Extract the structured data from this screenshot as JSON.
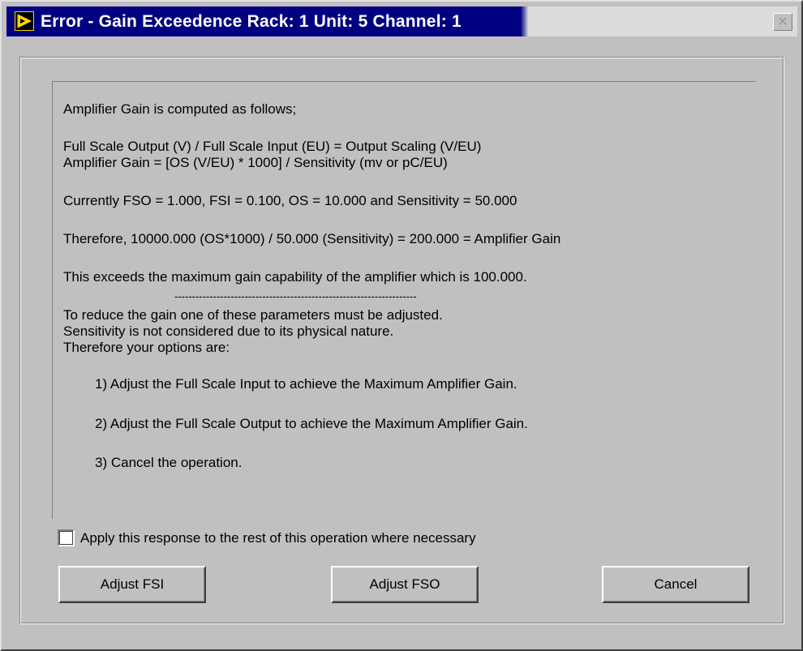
{
  "window": {
    "title": "Error - Gain Exceedence Rack: 1 Unit: 5 Channel: 1",
    "close_glyph": "✕"
  },
  "message": {
    "lines": [
      "Amplifier Gain is computed as follows;",
      "Full Scale Output (V) / Full Scale Input (EU) = Output Scaling (V/EU)",
      "Amplifier Gain = [OS (V/EU) * 1000] / Sensitivity (mv or pC/EU)",
      "Currently  FSO = 1.000, FSI = 0.100, OS = 10.000 and Sensitivity = 50.000",
      "Therefore,  10000.000  (OS*1000) / 50.000 (Sensitivity) = 200.000 = Amplifier Gain",
      "This exceeds the maximum gain capability of the amplifier which is 100.000.",
      "---------------------------------------------------------------------",
      "To reduce the gain one of these parameters must be adjusted.",
      "Sensitivity is not considered due to its physical nature.",
      "Therefore your options are:",
      "1) Adjust the Full Scale Input to achieve the Maximum Amplifier Gain.",
      "2) Adjust the Full Scale Output to achieve the Maximum Amplifier Gain.",
      "3) Cancel the operation."
    ]
  },
  "checkbox": {
    "label": "Apply this response to the rest of this operation where necessary",
    "checked": false
  },
  "buttons": {
    "adjust_fsi": "Adjust FSI",
    "adjust_fso": "Adjust FSO",
    "cancel": "Cancel"
  },
  "colors": {
    "titlebar": "#000080",
    "background": "#c0c0c0"
  }
}
